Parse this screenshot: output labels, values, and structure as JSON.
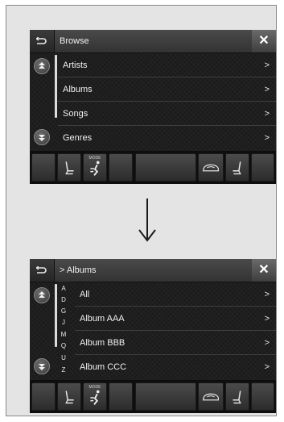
{
  "screen1": {
    "back_icon": "back-arrow-icon",
    "title": "Browse",
    "close_icon": "close-icon",
    "scroll_up_icon": "scroll-up-icon",
    "scroll_down_icon": "scroll-down-icon",
    "items": [
      {
        "label": "Artists",
        "arrow": ">"
      },
      {
        "label": "Albums",
        "arrow": ">"
      },
      {
        "label": "Songs",
        "arrow": ">"
      },
      {
        "label": "Genres",
        "arrow": ">"
      }
    ]
  },
  "transition_icon": "down-arrow-icon",
  "screen2": {
    "title": "> Albums",
    "alphabet": [
      "A",
      "D",
      "G",
      "J",
      "M",
      "Q",
      "U",
      "Z"
    ],
    "items": [
      {
        "label": "All",
        "arrow": ">"
      },
      {
        "label": "Album AAA",
        "arrow": ">"
      },
      {
        "label": "Album BBB",
        "arrow": ">"
      },
      {
        "label": "Album CCC",
        "arrow": ">"
      }
    ]
  },
  "bottom_bar": {
    "mode_label": "MODE",
    "buttons": [
      "blank",
      "seat-left-icon",
      "mode-fan-icon",
      "blank",
      "blank-wide",
      "recirculation-icon",
      "seat-right-icon",
      "blank"
    ]
  },
  "glyphs": {
    "back": "⊃",
    "close": "✕",
    "up": "▲",
    "down": "▼"
  }
}
